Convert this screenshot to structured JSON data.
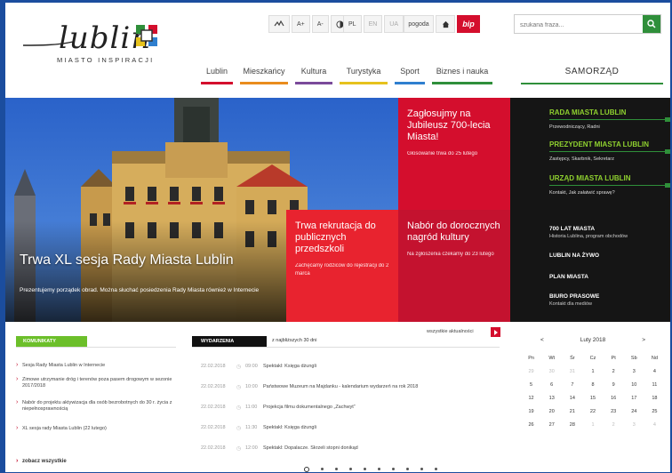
{
  "header": {
    "logo_text": "lublin",
    "logo_tagline": "MIASTO INSPIRACJI",
    "toolbar": {
      "text_size_labels": [
        "A+",
        "A-"
      ],
      "languages": [
        "PL",
        "EN",
        "UA"
      ],
      "weather_label": "pogoda",
      "bip_label": "bip"
    },
    "search": {
      "placeholder": "szukana fraza..."
    }
  },
  "nav": {
    "items": [
      {
        "label": "Lublin",
        "color": "#d40e2d"
      },
      {
        "label": "Mieszkańcy",
        "color": "#e98c1d"
      },
      {
        "label": "Kultura",
        "color": "#7a4a9a"
      },
      {
        "label": "Turystyka",
        "color": "#e6c21d"
      },
      {
        "label": "Sport",
        "color": "#2f7fcf"
      },
      {
        "label": "Biznes i nauka",
        "color": "#2f8f3a"
      }
    ],
    "samorzad_label": "SAMORZĄD"
  },
  "hero": {
    "title": "Trwa XL sesja Rady Miasta Lublin",
    "subtitle": "Prezentujemy porządek obrad. Można słuchać posiedzenia Rady Miasta również w Internecie"
  },
  "tiles": [
    {
      "title": "Zagłosujmy na Jubileusz 700-lecia Miasta!",
      "text": "Głosowanie trwa do 25 lutego",
      "color": "#d40e2d"
    },
    {
      "title": "Trwa rekrutacja do publicznych przedszkoli",
      "text": "Zachęcamy rodziców do rejestracji do 2 marca",
      "color": "#e8232f"
    },
    {
      "title": "Nabór do dorocznych nagród kultury",
      "text": "Na zgłoszenia czekamy do 23 lutego",
      "color": "#c4122f"
    }
  ],
  "dark_menu": {
    "sections": [
      {
        "title": "RADA MIASTA LUBLIN",
        "sub": "Przewodniczący, Radni"
      },
      {
        "title": "PREZYDENT MIASTA LUBLIN",
        "sub": "Zastępcy, Skarbnik, Sekretarz"
      },
      {
        "title": "URZĄD MIASTA LUBLIN",
        "sub": "Kontakt, Jak załatwić sprawę?"
      }
    ],
    "links": [
      {
        "title": "700 LAT MIASTA",
        "sub": "Historia Lublina, program obchodów"
      },
      {
        "title": "LUBLIN NA ŻYWO",
        "sub": ""
      },
      {
        "title": "PLAN MIASTA",
        "sub": ""
      },
      {
        "title": "BIURO PRASOWE",
        "sub": "Kontakt dla mediów"
      }
    ]
  },
  "komunikaty": {
    "label": "KOMUNIKATY",
    "items": [
      "Sesja Rady Miasta Lublin w Internecie",
      "Zimowe utrzymanie dróg i terenów poza pasem drogowym w sezonie 2017/2018",
      "Nabór do projektu aktywizacja dla osób bezrobotnych do 30 r. życia z niepełnosprawnością",
      "XL sesja rady Miasta Lublin (22 lutego)"
    ],
    "more_label": "zobacz wszystkie"
  },
  "events": {
    "label": "WYDARZENIA",
    "sub": "z najbliższych 30 dni",
    "all_news_label": "wszystkie aktualności",
    "items": [
      {
        "date": "22.02.2018",
        "time": "09:00",
        "name": "Spektakl: Księga dżungli"
      },
      {
        "date": "22.02.2018",
        "time": "10:00",
        "name": "Państwowe Muzeum na Majdanku - kalendarium wydarzeń na rok 2018"
      },
      {
        "date": "22.02.2018",
        "time": "11:00",
        "name": "Projekcja filmu dokumentalnego „Zachwyt”"
      },
      {
        "date": "22.02.2018",
        "time": "11:30",
        "name": "Spektakl: Księga dżungli"
      },
      {
        "date": "22.02.2018",
        "time": "12:00",
        "name": "Spektakl: Dopalacze. Skrzeli stopni donikąd"
      }
    ],
    "page_count": 10,
    "active_page": 1
  },
  "calendar": {
    "month_label": "Luty 2018",
    "prev_label": "<",
    "next_label": ">",
    "weekdays": [
      "Pn",
      "Wt",
      "Śr",
      "Cz",
      "Pt",
      "Sb",
      "Nd"
    ],
    "days": [
      {
        "d": "29",
        "off": true
      },
      {
        "d": "30",
        "off": true
      },
      {
        "d": "31",
        "off": true
      },
      {
        "d": "1"
      },
      {
        "d": "2"
      },
      {
        "d": "3"
      },
      {
        "d": "4"
      },
      {
        "d": "5"
      },
      {
        "d": "6"
      },
      {
        "d": "7"
      },
      {
        "d": "8"
      },
      {
        "d": "9"
      },
      {
        "d": "10"
      },
      {
        "d": "11"
      },
      {
        "d": "12"
      },
      {
        "d": "13"
      },
      {
        "d": "14"
      },
      {
        "d": "15"
      },
      {
        "d": "16"
      },
      {
        "d": "17"
      },
      {
        "d": "18"
      },
      {
        "d": "19"
      },
      {
        "d": "20"
      },
      {
        "d": "21"
      },
      {
        "d": "22"
      },
      {
        "d": "23"
      },
      {
        "d": "24"
      },
      {
        "d": "25"
      },
      {
        "d": "26"
      },
      {
        "d": "27"
      },
      {
        "d": "28"
      },
      {
        "d": "1",
        "off": true
      },
      {
        "d": "2",
        "off": true
      },
      {
        "d": "3",
        "off": true
      },
      {
        "d": "4",
        "off": true
      }
    ]
  },
  "colors": {
    "brand_red": "#d40e2d",
    "brand_green": "#2f8f3a",
    "lime": "#8fd12f",
    "dark_panel": "#151515"
  }
}
